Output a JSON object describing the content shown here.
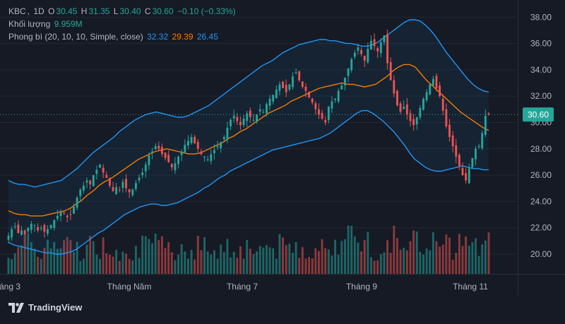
{
  "legend": {
    "symbol": "KBC",
    "interval": "1D",
    "o_label": "O",
    "o": "30.45",
    "h_label": "H",
    "h": "31.35",
    "l_label": "L",
    "l": "30.40",
    "c_label": "C",
    "c": "30.60",
    "change": "−0.10 (−0.33%)",
    "volume_label": "Khối lượng",
    "volume": "9.959M",
    "env_label": "Phong bì (20, 10, 10, Simple, close)",
    "env_upper": "32.32",
    "env_mid": "29.39",
    "env_lower": "26.45"
  },
  "price_tag": "30.60",
  "brand": "TradingView",
  "colors": {
    "background": "#161a25",
    "up": "#26a69a",
    "down": "#ef5350",
    "band": "#2196f3",
    "basis": "#f57c00",
    "price_line": "#26a69a"
  },
  "chart_data": {
    "type": "candlestick",
    "x_ticks": [
      "áng 3",
      "Tháng Năm",
      "Tháng 7",
      "Tháng 9",
      "Tháng 11"
    ],
    "y_ticks": [
      "38.00",
      "36.00",
      "34.00",
      "32.00",
      "30.00",
      "28.00",
      "26.00",
      "24.00",
      "22.00",
      "20.00"
    ],
    "ylim": [
      18.5,
      39.3
    ],
    "last_price": 30.6,
    "grid": true,
    "closes": [
      21.4,
      21.9,
      22.1,
      21.6,
      21.8,
      21.5,
      22.0,
      22.3,
      22.2,
      21.8,
      22.0,
      21.7,
      21.9,
      22.2,
      22.6,
      22.9,
      23.2,
      23.1,
      22.8,
      23.0,
      23.6,
      24.3,
      24.9,
      25.2,
      25.6,
      25.3,
      26.0,
      26.4,
      26.8,
      26.2,
      25.8,
      25.2,
      24.8,
      25.1,
      24.9,
      25.5,
      25.0,
      24.7,
      24.9,
      25.4,
      25.8,
      26.2,
      26.8,
      27.5,
      27.8,
      28.2,
      28.0,
      27.6,
      27.3,
      27.0,
      26.6,
      26.9,
      27.4,
      27.8,
      28.3,
      28.6,
      28.9,
      28.4,
      28.0,
      27.6,
      27.4,
      27.2,
      27.6,
      27.9,
      28.2,
      28.5,
      28.9,
      29.6,
      30.2,
      30.5,
      30.1,
      29.8,
      30.3,
      30.7,
      30.4,
      30.2,
      30.6,
      31.0,
      30.8,
      31.4,
      31.8,
      32.1,
      32.5,
      32.9,
      32.6,
      32.3,
      32.9,
      33.5,
      33.8,
      33.2,
      32.7,
      32.4,
      31.9,
      31.5,
      31.0,
      30.6,
      30.3,
      30.0,
      31.2,
      31.6,
      31.8,
      32.4,
      32.8,
      33.4,
      34.1,
      34.8,
      35.3,
      35.7,
      35.2,
      34.7,
      35.6,
      36.2,
      35.8,
      35.4,
      36.1,
      36.6,
      34.5,
      33.2,
      32.2,
      31.3,
      30.8,
      31.2,
      30.6,
      30.1,
      29.8,
      30.4,
      31.1,
      31.8,
      32.3,
      32.9,
      33.3,
      32.6,
      32.0,
      30.9,
      29.7,
      28.9,
      28.2,
      27.4,
      26.7,
      26.0,
      25.6,
      26.5,
      27.3,
      28.0,
      28.2,
      29.2,
      30.5,
      30.6
    ],
    "upper_band": [
      25.6,
      25.4,
      25.3,
      25.3,
      25.2,
      25.1,
      25.2,
      25.3,
      25.4,
      25.5,
      25.6,
      25.9,
      26.2,
      26.5,
      26.9,
      27.3,
      27.7,
      28.0,
      28.3,
      28.6,
      28.9,
      29.3,
      29.6,
      29.9,
      30.2,
      30.4,
      30.6,
      30.7,
      30.8,
      30.7,
      30.6,
      30.5,
      30.4,
      30.4,
      30.5,
      30.7,
      30.9,
      31.1,
      31.3,
      31.6,
      31.9,
      32.2,
      32.5,
      32.8,
      33.1,
      33.4,
      33.7,
      34.0,
      34.3,
      34.5,
      34.7,
      35.0,
      35.3,
      35.5,
      35.7,
      35.9,
      36.0,
      36.1,
      36.2,
      36.3,
      36.3,
      36.2,
      36.2,
      36.1,
      36.0,
      36.0,
      35.9,
      35.8,
      35.8,
      35.9,
      36.1,
      36.4,
      36.7,
      37.0,
      37.3,
      37.6,
      37.8,
      37.8,
      37.7,
      37.4,
      37.0,
      36.5,
      35.9,
      35.3,
      34.8,
      34.3,
      33.8,
      33.3,
      32.9,
      32.6,
      32.4,
      32.3
    ],
    "basis": [
      23.3,
      23.1,
      23.0,
      23.0,
      22.9,
      22.9,
      22.9,
      23.0,
      23.1,
      23.2,
      23.3,
      23.5,
      23.8,
      24.1,
      24.5,
      24.8,
      25.2,
      25.5,
      25.7,
      26.0,
      26.3,
      26.6,
      26.9,
      27.2,
      27.4,
      27.6,
      27.8,
      27.9,
      28.0,
      27.9,
      27.8,
      27.7,
      27.6,
      27.6,
      27.7,
      27.9,
      28.1,
      28.3,
      28.5,
      28.8,
      29.0,
      29.3,
      29.5,
      29.8,
      30.1,
      30.4,
      30.7,
      30.9,
      31.1,
      31.3,
      31.6,
      31.8,
      32.0,
      32.2,
      32.4,
      32.6,
      32.7,
      32.8,
      32.9,
      33.0,
      32.9,
      32.9,
      32.8,
      32.7,
      32.8,
      32.9,
      33.2,
      33.5,
      33.9,
      34.2,
      34.4,
      34.4,
      34.2,
      33.7,
      33.2,
      32.8,
      32.4,
      32.0,
      31.6,
      31.2,
      30.8,
      30.5,
      30.2,
      29.9,
      29.6,
      29.4
    ],
    "lower_band": [
      20.9,
      20.7,
      20.6,
      20.5,
      20.4,
      20.3,
      20.2,
      20.1,
      20.1,
      20.0,
      20.0,
      20.1,
      20.2,
      20.4,
      20.7,
      21.0,
      21.3,
      21.6,
      21.8,
      22.1,
      22.4,
      22.7,
      23.0,
      23.2,
      23.4,
      23.6,
      23.7,
      23.8,
      23.8,
      23.7,
      23.7,
      23.8,
      23.9,
      24.1,
      24.3,
      24.5,
      24.7,
      25.0,
      25.2,
      25.5,
      25.8,
      26.0,
      26.3,
      26.5,
      26.7,
      26.9,
      27.1,
      27.3,
      27.5,
      27.7,
      27.9,
      28.0,
      28.1,
      28.2,
      28.3,
      28.4,
      28.5,
      28.6,
      28.7,
      28.8,
      29.0,
      29.2,
      29.5,
      29.8,
      30.1,
      30.4,
      30.7,
      30.9,
      30.9,
      30.7,
      30.4,
      30.1,
      29.7,
      29.3,
      28.8,
      28.3,
      27.7,
      27.2,
      26.9,
      26.6,
      26.4,
      26.3,
      26.3,
      26.4,
      26.5,
      26.6,
      26.7,
      26.6,
      26.5,
      26.5,
      26.4,
      26.4
    ]
  }
}
